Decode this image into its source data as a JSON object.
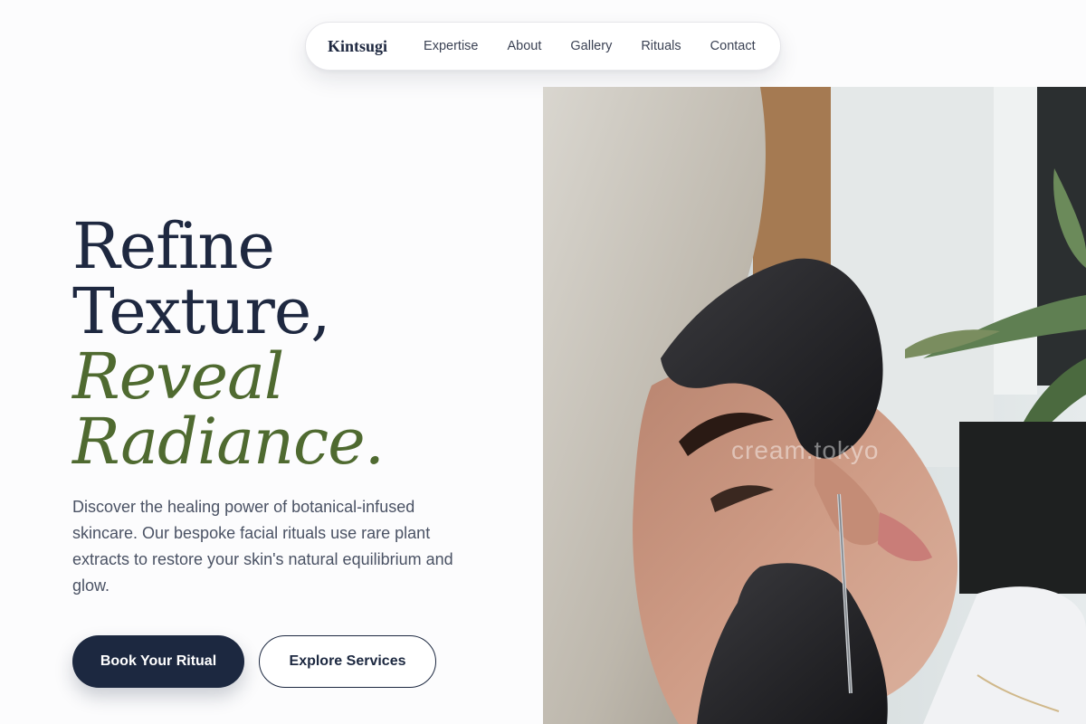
{
  "nav": {
    "brand": "Kintsugi",
    "links": [
      "Expertise",
      "About",
      "Gallery",
      "Rituals",
      "Contact"
    ]
  },
  "hero": {
    "headline_lines": [
      "Refine",
      "Texture,"
    ],
    "headline_accent_lines": [
      "Reveal",
      "Radiance."
    ],
    "description": "Discover the healing power of botanical-infused skincare. Our bespoke facial rituals use rare plant extracts to restore your skin's natural equilibrium and glow.",
    "primary_cta": "Book Your Ritual",
    "secondary_cta": "Explore Services",
    "image": {
      "watermark": "cream.tokyo"
    }
  },
  "colors": {
    "navy": "#1c2840",
    "olive_accent": "#4f6a30",
    "body_text": "#4a5264",
    "background": "#fcfcfd"
  }
}
